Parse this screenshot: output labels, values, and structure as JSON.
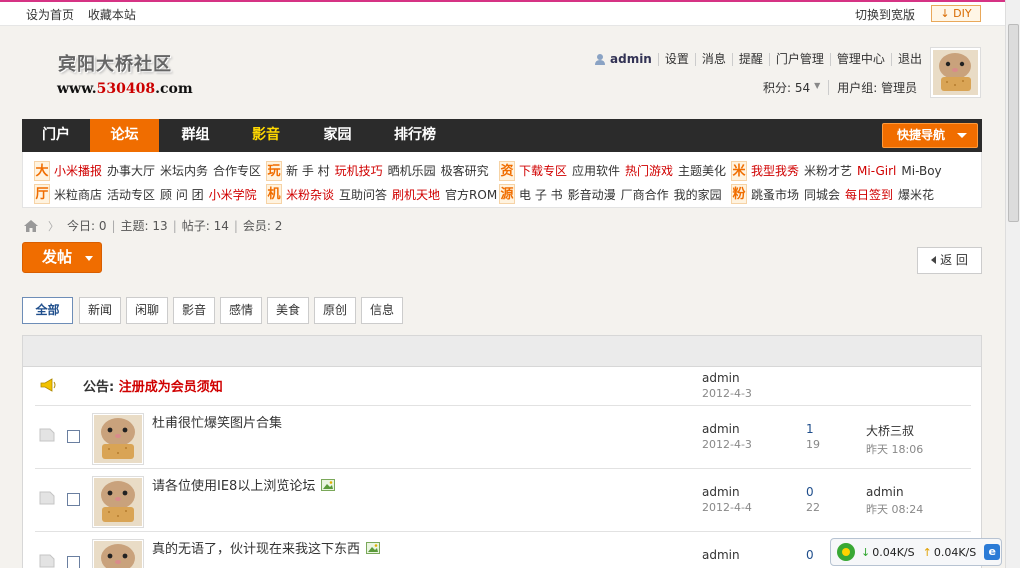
{
  "topbar": {
    "set_home": "设为首页",
    "bookmark": "收藏本站",
    "switch_wide": "切换到宽版",
    "diy": "DIY"
  },
  "header": {
    "site_name": "宾阳大桥社区",
    "domain_prefix": "www.",
    "domain_number": "530408",
    "domain_suffix": ".com"
  },
  "user": {
    "name": "admin",
    "links": [
      "设置",
      "消息",
      "提醒",
      "门户管理",
      "管理中心",
      "退出"
    ],
    "points_label": "积分: 54",
    "group_label": "用户组: 管理员"
  },
  "nav": {
    "items": [
      "门户",
      "论坛",
      "群组",
      "影音",
      "家园",
      "排行榜"
    ],
    "active": "论坛",
    "quick_nav": "快捷导航"
  },
  "subnav": {
    "groups": [
      {
        "badges": [
          "大",
          "厅"
        ],
        "row1": [
          {
            "t": "小米播报",
            "red": true
          },
          {
            "t": "办事大厅"
          },
          {
            "t": "米坛内务"
          },
          {
            "t": "合作专区"
          }
        ],
        "row2": [
          {
            "t": "米粒商店"
          },
          {
            "t": "活动专区"
          },
          {
            "t": "顾 问 团"
          },
          {
            "t": "小米学院",
            "red": true
          }
        ]
      },
      {
        "badges": [
          "玩",
          "机"
        ],
        "row1": [
          {
            "t": "新 手 村"
          },
          {
            "t": "玩机技巧",
            "red": true
          },
          {
            "t": "晒机乐园"
          },
          {
            "t": "极客研究"
          }
        ],
        "row2": [
          {
            "t": "米粉杂谈",
            "red": true
          },
          {
            "t": "互助问答"
          },
          {
            "t": "刷机天地",
            "red": true
          },
          {
            "t": "官方ROM"
          }
        ]
      },
      {
        "badges": [
          "资",
          "源"
        ],
        "row1": [
          {
            "t": "下载专区",
            "red": true
          },
          {
            "t": "应用软件"
          },
          {
            "t": "热门游戏",
            "red": true
          },
          {
            "t": "主题美化"
          }
        ],
        "row2": [
          {
            "t": "电 子 书"
          },
          {
            "t": "影音动漫"
          },
          {
            "t": "厂商合作"
          },
          {
            "t": "我的家园"
          }
        ]
      },
      {
        "badges": [
          "米",
          "粉"
        ],
        "row1": [
          {
            "t": "我型我秀",
            "red": true
          },
          {
            "t": "米粉才艺"
          },
          {
            "t": "Mi-Girl",
            "red": true
          },
          {
            "t": "Mi-Boy"
          }
        ],
        "row2": [
          {
            "t": "跳蚤市场"
          },
          {
            "t": "同城会"
          },
          {
            "t": "每日签到",
            "red": true
          },
          {
            "t": "爆米花"
          }
        ]
      }
    ]
  },
  "stats": {
    "today": "今日: 0",
    "topics": "主题: 13",
    "posts": "帖子: 14",
    "members": "会员: 2"
  },
  "actions": {
    "post": "发帖",
    "back": "返 回"
  },
  "categories": [
    "全部",
    "新闻",
    "闲聊",
    "影音",
    "感情",
    "美食",
    "原创",
    "信息"
  ],
  "announcement": {
    "prefix": "公告: ",
    "title": "注册成为会员须知",
    "author": "admin",
    "date": "2012-4-3"
  },
  "threads": [
    {
      "title": "杜甫很忙爆笑图片合集",
      "has_image": false,
      "author": "admin",
      "date": "2012-4-3",
      "replies": "1",
      "views": "19",
      "last_user": "大桥三叔",
      "last_time": "昨天 18:06"
    },
    {
      "title": "请各位使用IE8以上浏览论坛",
      "has_image": true,
      "author": "admin",
      "date": "2012-4-4",
      "replies": "0",
      "views": "22",
      "last_user": "admin",
      "last_time": "昨天 08:24"
    },
    {
      "title": "真的无语了，伙计现在来我这下东西",
      "has_image": true,
      "author": "admin",
      "date": "",
      "replies": "0",
      "views": "",
      "last_user": "",
      "last_time": ""
    }
  ],
  "speed": {
    "down": "0.04K/S",
    "up": "0.04K/S"
  },
  "colors": {
    "accent": "#f06d00",
    "nav_bg": "#2b2b2b",
    "link_red": "#d00000"
  }
}
